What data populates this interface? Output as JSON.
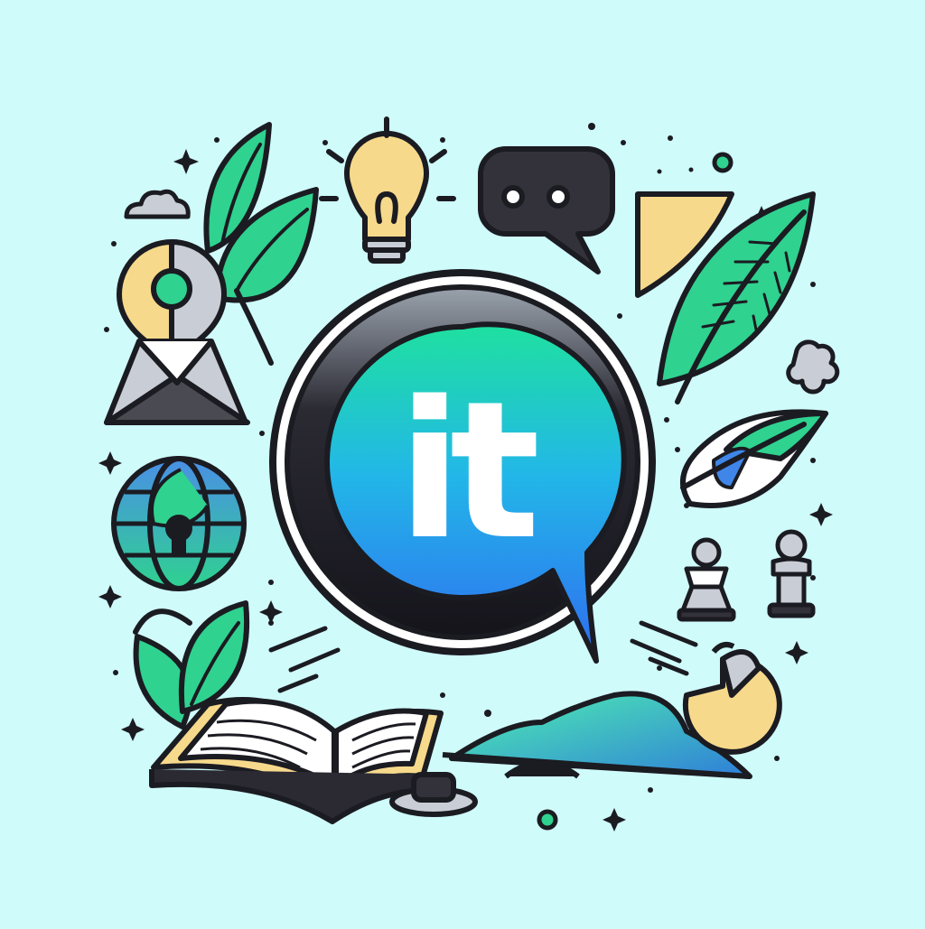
{
  "logo": {
    "text": "it",
    "colors": {
      "background": "#cffbfa",
      "outline": "#1b1b22",
      "ring_dark": "#1c1a24",
      "badge_top": "#1fe0a0",
      "badge_mid": "#22b7e8",
      "badge_bottom": "#2f6cf0",
      "leaf": "#2fd28f",
      "leaf_light": "#6fe9b0",
      "accent_yellow": "#f6d98b",
      "grey": "#c9cdd6",
      "globe_blue": "#3f86e8"
    }
  },
  "icons": [
    "chat-bubble-icon",
    "lightbulb-icon",
    "leaf-icon",
    "map-pin-icon",
    "envelope-icon",
    "globe-icon",
    "open-book-icon",
    "feather-icon",
    "chess-pawn-icon",
    "cloud-icon",
    "sparkle-icon"
  ]
}
